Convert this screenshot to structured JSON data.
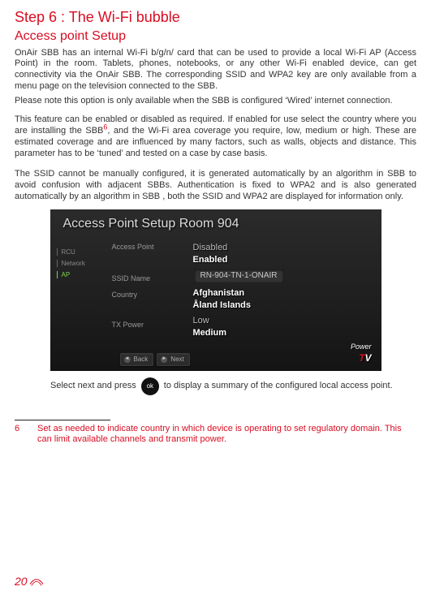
{
  "step_title": "Step 6 : The Wi-Fi bubble",
  "sub_title": "Access point Setup",
  "paragraphs": {
    "p1": "OnAir SBB has an internal Wi-Fi b/g/n/ card that can be used to provide a local Wi-Fi AP (Access Point) in the room. Tablets, phones, notebooks, or any other Wi-Fi enabled device, can get connectivity via the OnAir SBB. The corresponding SSID and WPA2 key are only available from a menu page on the television connected to the SBB.",
    "p2": "Please note this option is only available when the SBB is configured ‘Wired’ internet connection.",
    "p3a": "This feature can be enabled or disabled as required. If enabled for use select the country where you are installing the SBB",
    "p3_ref": "6",
    "p3b": ",   and the Wi-Fi area coverage you require, low, medium or high. These are estimated coverage and are influenced by many factors, such as walls, objects and distance. This parameter has to be ‘tuned’ and tested on a case by case basis.",
    "p4": "The SSID cannot be manually configured, it is generated automatically by an algorithm in SBB to avoid confusion with adjacent SBBs. Authentication is fixed to WPA2 and is also generated automatically by an algorithm in SBB , both the SSID and WPA2 are displayed for information only."
  },
  "screenshot": {
    "title": "Access Point Setup Room 904",
    "left_nav": {
      "rcu": "RCU",
      "network": "Network",
      "ap": "AP"
    },
    "labels": {
      "ap": "Access Point",
      "ssid": "SSID Name",
      "country": "Country",
      "tx": "TX Power"
    },
    "ap_options": {
      "disabled": "Disabled",
      "enabled": "Enabled"
    },
    "ssid_value": "RN-904-TN-1-ONAIR",
    "country_options": {
      "opt1": "Afghanistan",
      "opt2": "Åland Islands"
    },
    "tx_options": {
      "low": "Low",
      "medium": "Medium"
    },
    "nav": {
      "back_sym": "◄",
      "back": "Back",
      "next_sym": "►",
      "next": "Next"
    },
    "logo": {
      "power": "Power",
      "t": "T",
      "v": "V"
    }
  },
  "caption": {
    "before": "Select next and press",
    "ok": "ok",
    "after": "to display a summary of the configured local access point."
  },
  "footnote": {
    "num": "6",
    "text": "Set as needed to indicate country in which device is operating to set regulatory domain. This can limit available channels and transmit power."
  },
  "page_number": "20"
}
